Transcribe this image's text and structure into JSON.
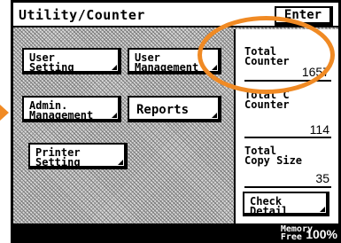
{
  "window": {
    "title": "Utility/Counter",
    "enter_label": "Enter"
  },
  "buttons": {
    "user_setting": [
      "User",
      "Setting"
    ],
    "user_management": [
      "User",
      "Management"
    ],
    "admin_management": [
      "Admin.",
      "Management"
    ],
    "reports": "Reports",
    "printer_setting": [
      "Printer",
      "Setting"
    ],
    "check_detail": [
      "Check",
      "Detail"
    ]
  },
  "counters": [
    {
      "label_lines": [
        "Total",
        "Counter"
      ],
      "value": "1657"
    },
    {
      "label_lines": [
        "Total C",
        "Counter"
      ],
      "value": "114"
    },
    {
      "label_lines": [
        "Total",
        "Copy Size"
      ],
      "value": "35"
    }
  ],
  "status": {
    "memory_label": [
      "Memory",
      "Free"
    ],
    "memory_value": "100%"
  },
  "colors": {
    "highlight": "#f08a24",
    "background": "#000000",
    "panel": "#ffffff"
  }
}
